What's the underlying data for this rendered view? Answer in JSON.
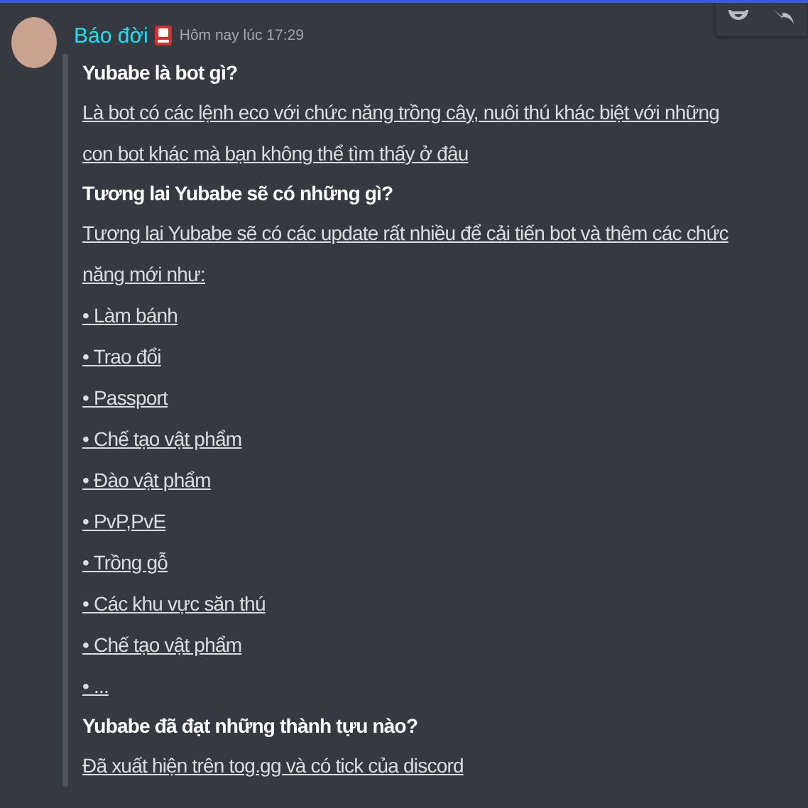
{
  "message": {
    "author": "Báo đời",
    "timestamp": "Hôm nay lúc 17:29",
    "lines": [
      {
        "kind": "heading",
        "text": "Yubabe là bot gì?"
      },
      {
        "kind": "link",
        "text": "Là bot có các lệnh eco với chức năng trồng cây, nuôi thú khác biệt với những con bot khác mà bạn không thể tìm thấy ở đâu"
      },
      {
        "kind": "heading",
        "text": "Tương lai Yubabe sẽ có những gì?"
      },
      {
        "kind": "link",
        "text": "Tương lai Yubabe sẽ có các update rất nhiều để cải tiến bot và thêm các chức năng mới như:"
      },
      {
        "kind": "link",
        "text": "• Làm bánh"
      },
      {
        "kind": "link",
        "text": "• Trao đổi"
      },
      {
        "kind": "link",
        "text": "• Passport"
      },
      {
        "kind": "link",
        "text": "• Chế tạo vật phẩm"
      },
      {
        "kind": "link",
        "text": "• Đào vật phẩm"
      },
      {
        "kind": "link",
        "text": "• PvP,PvE"
      },
      {
        "kind": "link",
        "text": "• Trồng gỗ"
      },
      {
        "kind": "link",
        "text": "• Các khu vực săn thú"
      },
      {
        "kind": "link",
        "text": "• Chế tạo vật phẩm"
      },
      {
        "kind": "link",
        "text": "• ..."
      },
      {
        "kind": "heading",
        "text": "Yubabe đã đạt những thành tựu nào?"
      },
      {
        "kind": "link",
        "text": "Đã xuất hiện trên tog.gg và có tick của discord"
      }
    ]
  }
}
